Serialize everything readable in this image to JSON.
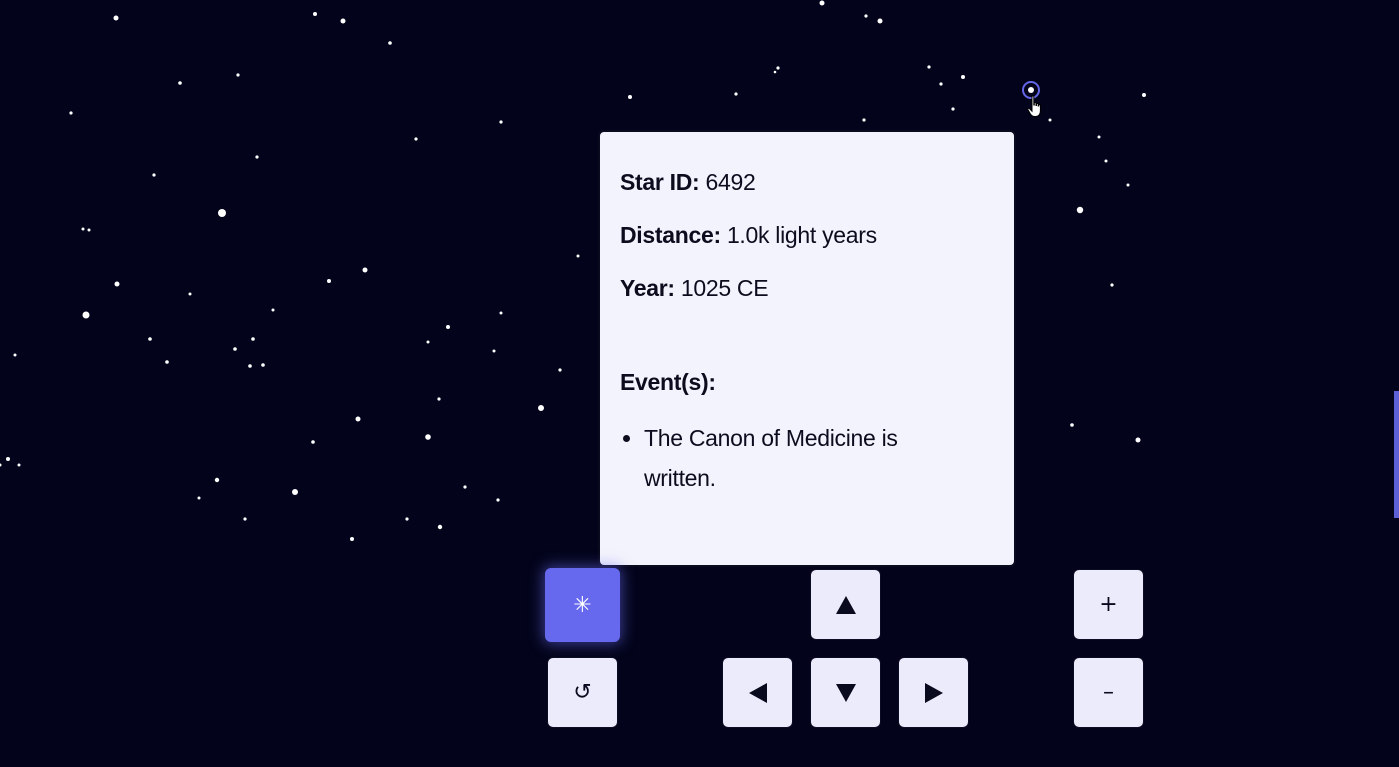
{
  "star_info": {
    "star_id_label": "Star ID:",
    "star_id_value": "6492",
    "distance_label": "Distance:",
    "distance_value": "1.0k light years",
    "year_label": "Year:",
    "year_value": "1025 CE",
    "events_label": "Event(s):",
    "events": [
      "The Canon of Medicine is written."
    ]
  },
  "controls": {
    "constellation_symbol": "✳",
    "reset_symbol": "↺",
    "zoom_in_symbol": "+",
    "zoom_out_symbol": "–"
  },
  "colors": {
    "background": "#03041b",
    "accent": "#6668ee",
    "button_bg": "#ecebfb",
    "popup_bg": "#f3f3fd",
    "star": "#ffffff"
  },
  "icons": {
    "constellation_button": "asterisk-icon",
    "reset_button": "rotate-ccw-icon",
    "pan_up": "arrow-up-icon",
    "pan_down": "arrow-down-icon",
    "pan_left": "arrow-left-icon",
    "pan_right": "arrow-right-icon",
    "zoom_in": "plus-icon",
    "zoom_out": "minus-icon",
    "cursor": "pointer-hand-icon"
  }
}
